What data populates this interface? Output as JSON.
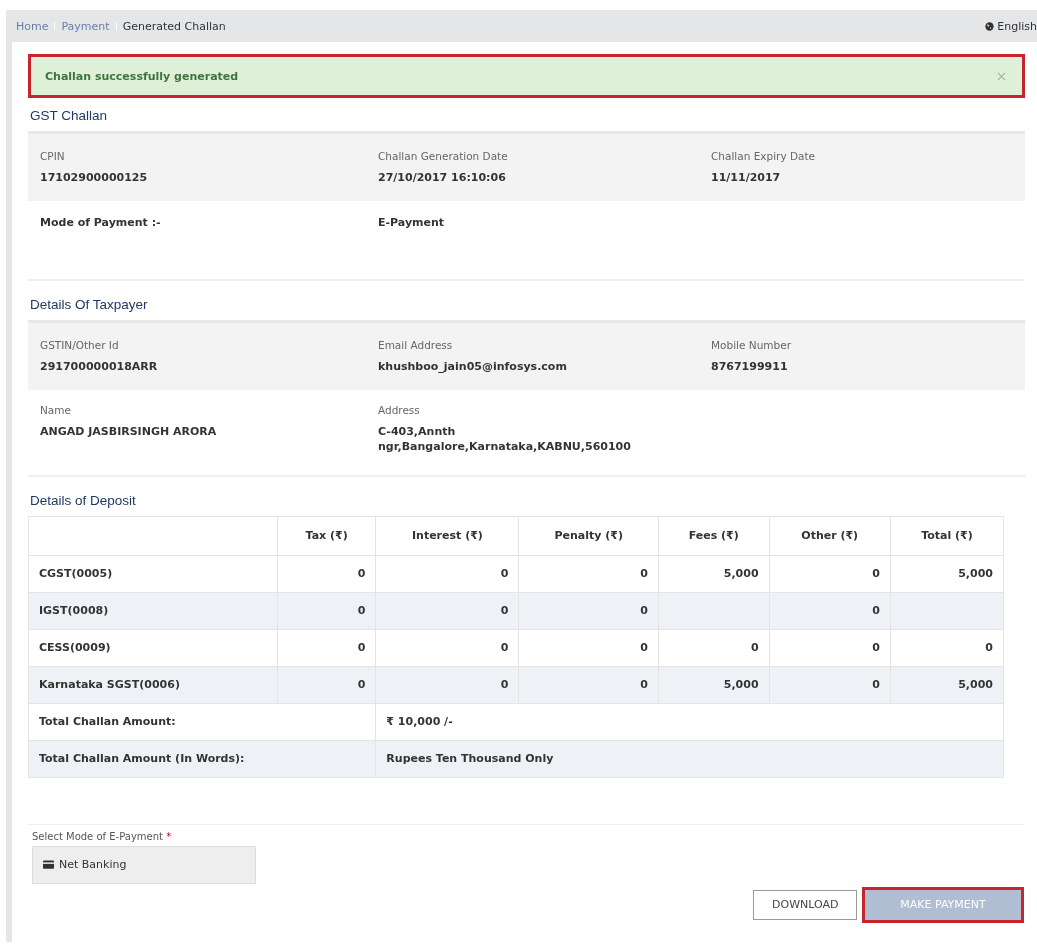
{
  "breadcrumb": [
    {
      "label": "Home",
      "link": true
    },
    {
      "label": "Payment",
      "link": true
    },
    {
      "label": "Generated Challan",
      "link": false
    }
  ],
  "language": "English",
  "alert": {
    "message": "Challan successfully generated",
    "highlighted": true
  },
  "sections": [
    {
      "title": "GST Challan",
      "blocks": [
        {
          "shaded": true,
          "fields": [
            {
              "label": "CPIN",
              "value": "17102900000125"
            },
            {
              "label": "Challan Generation Date",
              "value": "27/10/2017 16:10:06"
            },
            {
              "label": "Challan Expiry Date",
              "value": "11/11/2017"
            }
          ]
        },
        {
          "shaded": false,
          "fields": [
            {
              "value": "Mode of Payment :-"
            },
            {
              "value": "E-Payment"
            }
          ]
        }
      ]
    },
    {
      "title": "Details Of Taxpayer",
      "blocks": [
        {
          "shaded": true,
          "fields": [
            {
              "label": "GSTIN/Other Id",
              "value": "291700000018ARR"
            },
            {
              "label": "Email Address",
              "value": "khushboo_jain05@infosys.com"
            },
            {
              "label": "Mobile Number",
              "value": "8767199911"
            }
          ]
        },
        {
          "shaded": false,
          "fields": [
            {
              "label": "Name",
              "value": "ANGAD JASBIRSINGH ARORA"
            },
            {
              "label": "Address",
              "value": "C-403,Annth ngr,Bangalore,Karnataka,KABNU,560100"
            }
          ]
        }
      ]
    }
  ],
  "deposit": {
    "title": "Details of Deposit",
    "columns": [
      "Tax (₹)",
      "Interest (₹)",
      "Penalty (₹)",
      "Fees (₹)",
      "Other (₹)",
      "Total (₹)"
    ],
    "rows": [
      {
        "head": "CGST(0005)",
        "cells": [
          "0",
          "0",
          "0",
          "5,000",
          "0",
          "5,000"
        ]
      },
      {
        "head": "IGST(0008)",
        "cells": [
          "0",
          "0",
          "0",
          "",
          "0",
          ""
        ]
      },
      {
        "head": "CESS(0009)",
        "cells": [
          "0",
          "0",
          "0",
          "0",
          "0",
          "0"
        ]
      },
      {
        "head": "Karnataka SGST(0006)",
        "cells": [
          "0",
          "0",
          "0",
          "5,000",
          "0",
          "5,000"
        ]
      }
    ],
    "totals": [
      {
        "label": "Total Challan Amount:",
        "value": "₹ 10,000 /-"
      },
      {
        "label": "Total Challan Amount (In Words):",
        "value": "Rupees Ten Thousand Only"
      }
    ]
  },
  "payment_mode": {
    "label": "Select Mode of E-Payment",
    "required_mark": "*",
    "option": "Net Banking"
  },
  "buttons": [
    {
      "label": "DOWNLOAD",
      "kind": "outline",
      "disabled": false,
      "highlighted": false
    },
    {
      "label": "MAKE PAYMENT",
      "kind": "primary",
      "disabled": true,
      "highlighted": true
    }
  ]
}
